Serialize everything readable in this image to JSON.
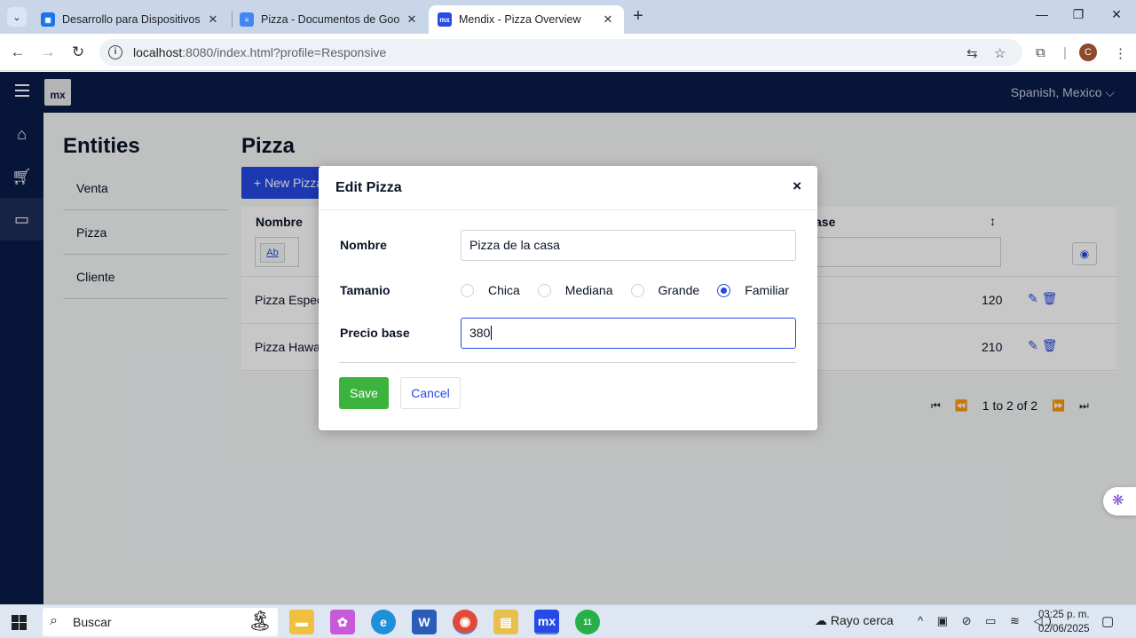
{
  "browser": {
    "tabs": [
      {
        "title": "Desarrollo para Dispositivos Int",
        "favicon_color": "#1a73e8",
        "active": false
      },
      {
        "title": "Pizza - Documentos de Google",
        "favicon_color": "#4285f4",
        "active": false
      },
      {
        "title": "Mendix - Pizza Overview",
        "favicon_color": "#264ae5",
        "favicon_text": "mx",
        "active": true
      }
    ],
    "url_host": "localhost",
    "url_rest": ":8080/index.html?profile=Responsive",
    "profile_initial": "C"
  },
  "app": {
    "logo": "mx",
    "language": "Spanish, Mexico",
    "sidebar_icons": [
      "home-icon",
      "cart-icon",
      "card-icon"
    ],
    "entities_title": "Entities",
    "entities": [
      "Venta",
      "Pizza",
      "Cliente"
    ],
    "page_title": "Pizza",
    "new_button": "+ New Pizza",
    "grid": {
      "col_nombre": "Nombre",
      "col_base": "ase",
      "filter_label": "Ab",
      "rows": [
        {
          "nombre": "Pizza Especi",
          "precio": "120"
        },
        {
          "nombre": "Pizza Hawai",
          "precio": "210"
        }
      ]
    },
    "pager": "1 to 2 of 2"
  },
  "dialog": {
    "title": "Edit Pizza",
    "close": "×",
    "nombre_label": "Nombre",
    "nombre_value": "Pizza de la casa",
    "tamanio_label": "Tamanio",
    "tamanio_options": [
      "Chica",
      "Mediana",
      "Grande",
      "Familiar"
    ],
    "tamanio_selected": "Familiar",
    "precio_label": "Precio base",
    "precio_value": "380",
    "save": "Save",
    "cancel": "Cancel"
  },
  "taskbar": {
    "search_placeholder": "Buscar",
    "weather": "Rayo cerca",
    "time": "03:25 p. m.",
    "date": "02/06/2025",
    "whatsapp_badge": "11"
  },
  "colors": {
    "mendix_navy": "#0a1b4a",
    "primary": "#264ae5",
    "success": "#3cb33d"
  }
}
